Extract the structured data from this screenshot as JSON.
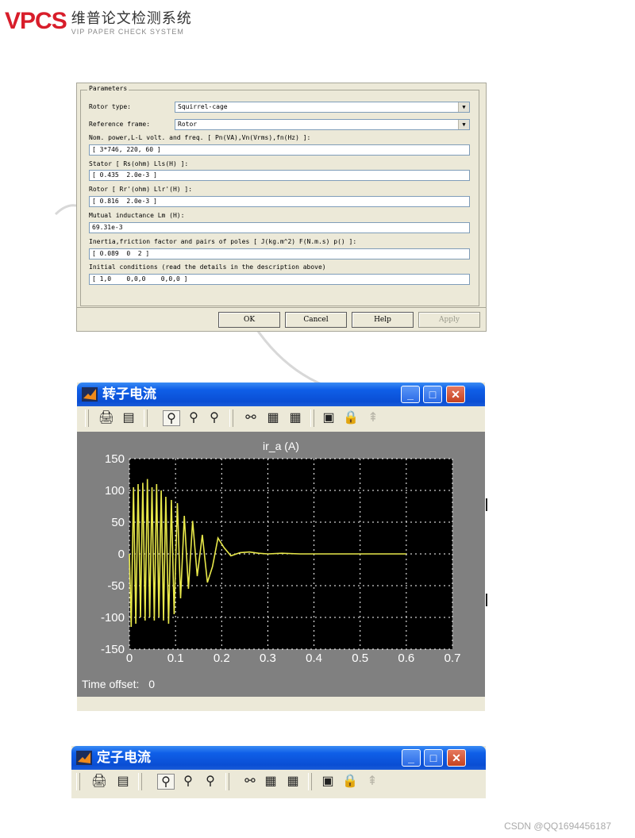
{
  "logo": {
    "mark": "VPCS",
    "cn": "维普论文检测系统",
    "en": "VIP PAPER CHECK SYSTEM"
  },
  "dialog": {
    "legend": "Parameters",
    "rotor_type_label": "Rotor type:",
    "rotor_type_value": "Squirrel-cage",
    "ref_frame_label": "Reference frame:",
    "ref_frame_value": "Rotor",
    "nom_label": "Nom. power,L-L volt. and freq. [ Pn(VA),Vn(Vrms),fn(Hz) ]:",
    "nom_value": "[ 3*746, 220, 60 ]",
    "stator_label": "Stator [ Rs(ohm)  Lls(H) ]:",
    "stator_value": "[ 0.435  2.0e-3 ]",
    "rotor_label": "Rotor [ Rr'(ohm)  Llr'(H) ]:",
    "rotor_value": "[ 0.816  2.0e-3 ]",
    "mutual_label": "Mutual inductance Lm (H):",
    "mutual_value": "69.31e-3",
    "inertia_label": "Inertia,friction factor and pairs of poles [ J(kg.m^2)  F(N.m.s)  p() ]:",
    "inertia_value": "[ 0.089  0  2 ]",
    "initial_label": "Initial conditions  (read the details in the description above)",
    "initial_value": "[ 1,0    0,0,0    0,0,0 ]",
    "buttons": {
      "ok": "OK",
      "cancel": "Cancel",
      "help": "Help",
      "apply": "Apply"
    }
  },
  "rotor_window": {
    "title": "转子电流",
    "plot_title": "ir_a (A)",
    "time_offset_label": "Time offset:",
    "time_offset_value": "0"
  },
  "stator_window": {
    "title": "定子电流"
  },
  "toolbar_icons": [
    "print-icon",
    "params-icon",
    "zoom-icon",
    "zoom-x-icon",
    "zoom-y-icon",
    "autoscale-icon",
    "save-axes-icon",
    "restore-axes-icon",
    "floating-scope-icon",
    "lock-icon",
    "signal-select-icon"
  ],
  "colors": {
    "trace": "#e8e84a",
    "plot_bg": "#000000",
    "scope_bg": "#808080",
    "titlebar": "#0a4ed4"
  },
  "chart_data": {
    "type": "line",
    "title": "ir_a (A)",
    "xlabel": "",
    "ylabel": "",
    "xlim": [
      0,
      0.7
    ],
    "ylim": [
      -150,
      150
    ],
    "xticks": [
      "0",
      "0.1",
      "0.2",
      "0.3",
      "0.4",
      "0.5",
      "0.6",
      "0.7"
    ],
    "yticks": [
      "150",
      "100",
      "50",
      "0",
      "-50",
      "-100",
      "-150"
    ],
    "grid": true,
    "series": [
      {
        "x": [
          0,
          0.004,
          0.009,
          0.014,
          0.019,
          0.024,
          0.029,
          0.034,
          0.039,
          0.044,
          0.049,
          0.054,
          0.059,
          0.064,
          0.069,
          0.074,
          0.079,
          0.085,
          0.091,
          0.097,
          0.104,
          0.111,
          0.119,
          0.128,
          0.137,
          0.147,
          0.158,
          0.169,
          0.18,
          0.192,
          0.205,
          0.22,
          0.24,
          0.26,
          0.28,
          0.3,
          0.33,
          0.37,
          0.45,
          0.6
        ],
        "y": [
          0,
          -115,
          105,
          -110,
          110,
          -100,
          112,
          -105,
          118,
          -100,
          105,
          -105,
          110,
          -100,
          100,
          -105,
          90,
          -110,
          85,
          -95,
          80,
          -70,
          60,
          -55,
          52,
          -35,
          30,
          -45,
          -20,
          25,
          10,
          -3,
          2,
          3,
          1,
          0,
          1,
          0,
          0,
          0
        ]
      }
    ]
  },
  "footer": "CSDN @QQ1694456187"
}
